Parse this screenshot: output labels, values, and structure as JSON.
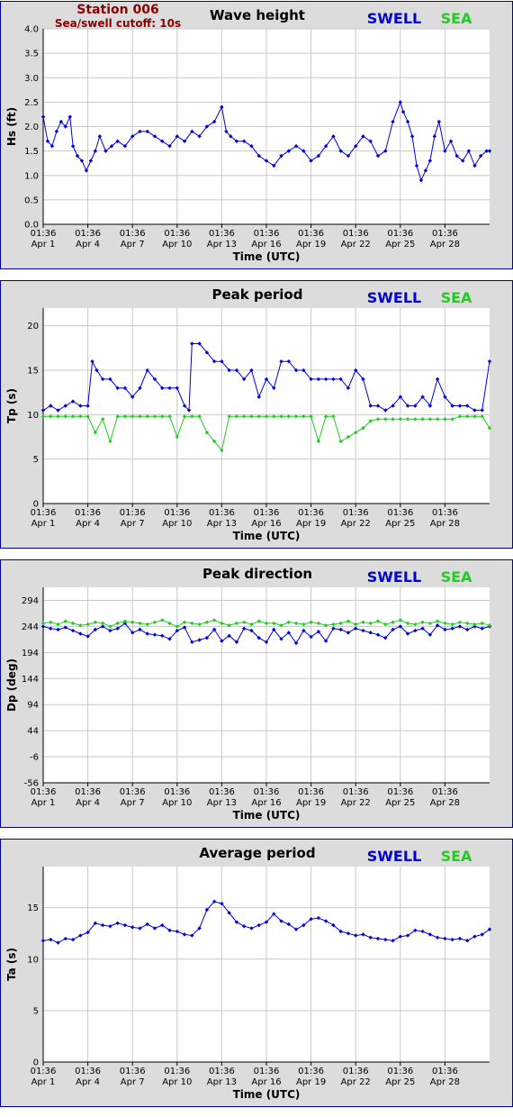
{
  "header": {
    "station": "Station 006",
    "cutoff": "Sea/swell cutoff: 10s"
  },
  "legend": {
    "swell": "SWELL",
    "sea": "SEA"
  },
  "colors": {
    "swell": "#0000dd",
    "sea": "#22cc22",
    "frame": "#0000a0"
  },
  "x_ticks": [
    {
      "time": "01:36",
      "date": "Apr 1",
      "day": 0
    },
    {
      "time": "01:36",
      "date": "Apr 4",
      "day": 3
    },
    {
      "time": "01:36",
      "date": "Apr 7",
      "day": 6
    },
    {
      "time": "01:36",
      "date": "Apr 10",
      "day": 9
    },
    {
      "time": "01:36",
      "date": "Apr 13",
      "day": 12
    },
    {
      "time": "01:36",
      "date": "Apr 16",
      "day": 15
    },
    {
      "time": "01:36",
      "date": "Apr 19",
      "day": 18
    },
    {
      "time": "01:36",
      "date": "Apr 22",
      "day": 21
    },
    {
      "time": "01:36",
      "date": "Apr 25",
      "day": 24
    },
    {
      "time": "01:36",
      "date": "Apr 28",
      "day": 27
    }
  ],
  "chart_data": [
    {
      "type": "line",
      "title": "Wave height",
      "xlabel": "Time (UTC)",
      "ylabel": "Hs (ft)",
      "xlim": [
        0,
        30
      ],
      "ylim": [
        0,
        4
      ],
      "yticks": [
        "0.0",
        "0.5",
        "1.0",
        "1.5",
        "2.0",
        "2.5",
        "3.0",
        "3.5",
        "4.0"
      ],
      "grid": true,
      "series": [
        {
          "name": "SWELL",
          "color": "#0000dd",
          "x": [
            0,
            0.3,
            0.6,
            0.9,
            1.2,
            1.5,
            1.8,
            2.0,
            2.3,
            2.6,
            2.9,
            3.2,
            3.5,
            3.8,
            4.2,
            4.6,
            5.0,
            5.5,
            6.0,
            6.5,
            7.0,
            7.5,
            8.0,
            8.5,
            9.0,
            9.5,
            10.0,
            10.5,
            11.0,
            11.5,
            12.0,
            12.3,
            12.6,
            13.0,
            13.5,
            14.0,
            14.5,
            15.0,
            15.5,
            16.0,
            16.5,
            17.0,
            17.5,
            18.0,
            18.5,
            19.0,
            19.5,
            20.0,
            20.5,
            21.0,
            21.5,
            22.0,
            22.5,
            23.0,
            23.5,
            24.0,
            24.2,
            24.5,
            24.8,
            25.1,
            25.4,
            25.7,
            26.0,
            26.3,
            26.6,
            27.0,
            27.4,
            27.8,
            28.2,
            28.6,
            29.0,
            29.4,
            29.8,
            30.0
          ],
          "y": [
            2.2,
            1.7,
            1.6,
            1.9,
            2.1,
            2.0,
            2.2,
            1.6,
            1.4,
            1.3,
            1.1,
            1.3,
            1.5,
            1.8,
            1.5,
            1.6,
            1.7,
            1.6,
            1.8,
            1.9,
            1.9,
            1.8,
            1.7,
            1.6,
            1.8,
            1.7,
            1.9,
            1.8,
            2.0,
            2.1,
            2.4,
            1.9,
            1.8,
            1.7,
            1.7,
            1.6,
            1.4,
            1.3,
            1.2,
            1.4,
            1.5,
            1.6,
            1.5,
            1.3,
            1.4,
            1.6,
            1.8,
            1.5,
            1.4,
            1.6,
            1.8,
            1.7,
            1.4,
            1.5,
            2.1,
            2.5,
            2.3,
            2.1,
            1.8,
            1.2,
            0.9,
            1.1,
            1.3,
            1.8,
            2.1,
            1.5,
            1.7,
            1.4,
            1.3,
            1.5,
            1.2,
            1.4,
            1.5,
            1.5
          ]
        }
      ]
    },
    {
      "type": "line",
      "title": "Peak period",
      "xlabel": "Time (UTC)",
      "ylabel": "Tp (s)",
      "xlim": [
        0,
        30
      ],
      "ylim": [
        0,
        22
      ],
      "yticks": [
        "0",
        "5",
        "10",
        "15",
        "20"
      ],
      "grid": true,
      "series": [
        {
          "name": "SWELL",
          "color": "#0000dd",
          "x": [
            0,
            0.5,
            1.0,
            1.5,
            2.0,
            2.5,
            3.0,
            3.3,
            3.6,
            4.0,
            4.5,
            5.0,
            5.5,
            6.0,
            6.5,
            7.0,
            7.5,
            8.0,
            8.5,
            9.0,
            9.5,
            9.8,
            10.0,
            10.5,
            11.0,
            11.5,
            12.0,
            12.5,
            13.0,
            13.5,
            14.0,
            14.5,
            15.0,
            15.5,
            16.0,
            16.5,
            17.0,
            17.5,
            18.0,
            18.5,
            19.0,
            19.5,
            20.0,
            20.5,
            21.0,
            21.5,
            22.0,
            22.5,
            23.0,
            23.5,
            24.0,
            24.5,
            25.0,
            25.5,
            26.0,
            26.5,
            27.0,
            27.5,
            28.0,
            28.5,
            29.0,
            29.5,
            30.0
          ],
          "y": [
            10.5,
            11,
            10.5,
            11,
            11.5,
            11,
            11,
            16,
            15,
            14,
            14,
            13,
            13,
            12,
            13,
            15,
            14,
            13,
            13,
            13,
            11,
            10.5,
            18,
            18,
            17,
            16,
            16,
            15,
            15,
            14,
            15,
            12,
            14,
            13,
            16,
            16,
            15,
            15,
            14,
            14,
            14,
            14,
            14,
            13,
            15,
            14,
            11,
            11,
            10.5,
            11,
            12,
            11,
            11,
            12,
            11,
            14,
            12,
            11,
            11,
            11,
            10.5,
            10.5,
            16
          ]
        },
        {
          "name": "SEA",
          "color": "#22cc22",
          "x": [
            0,
            0.5,
            1.0,
            1.5,
            2.0,
            2.5,
            3.0,
            3.5,
            4.0,
            4.5,
            5.0,
            5.5,
            6.0,
            6.5,
            7.0,
            7.5,
            8.0,
            8.5,
            9.0,
            9.5,
            10.0,
            10.5,
            11.0,
            11.5,
            12.0,
            12.5,
            13.0,
            13.5,
            14.0,
            14.5,
            15.0,
            15.5,
            16.0,
            16.5,
            17.0,
            17.5,
            18.0,
            18.5,
            19.0,
            19.5,
            20.0,
            20.5,
            21.0,
            21.5,
            22.0,
            22.5,
            23.0,
            23.5,
            24.0,
            24.5,
            25.0,
            25.5,
            26.0,
            26.5,
            27.0,
            27.5,
            28.0,
            28.5,
            29.0,
            29.5,
            30.0
          ],
          "y": [
            9.8,
            9.8,
            9.8,
            9.8,
            9.8,
            9.8,
            9.8,
            8,
            9.5,
            7,
            9.8,
            9.8,
            9.8,
            9.8,
            9.8,
            9.8,
            9.8,
            9.8,
            7.5,
            9.8,
            9.8,
            9.8,
            8,
            7,
            6,
            9.8,
            9.8,
            9.8,
            9.8,
            9.8,
            9.8,
            9.8,
            9.8,
            9.8,
            9.8,
            9.8,
            9.8,
            7,
            9.8,
            9.8,
            7,
            7.5,
            8,
            8.5,
            9.3,
            9.5,
            9.5,
            9.5,
            9.5,
            9.5,
            9.5,
            9.5,
            9.5,
            9.5,
            9.5,
            9.5,
            9.8,
            9.8,
            9.8,
            9.8,
            8.5
          ]
        }
      ]
    },
    {
      "type": "line",
      "title": "Peak direction",
      "xlabel": "Time (UTC)",
      "ylabel": "Dp (deg)",
      "xlim": [
        0,
        30
      ],
      "ylim": [
        -56,
        319
      ],
      "yticks": [
        "-56",
        "-6",
        "44",
        "94",
        "144",
        "194",
        "244",
        "294"
      ],
      "grid": true,
      "series": [
        {
          "name": "SWELL",
          "color": "#0000dd",
          "x": [
            0,
            0.5,
            1.0,
            1.5,
            2.0,
            2.5,
            3.0,
            3.5,
            4.0,
            4.5,
            5.0,
            5.5,
            6.0,
            6.5,
            7.0,
            7.5,
            8.0,
            8.5,
            9.0,
            9.5,
            10.0,
            10.5,
            11.0,
            11.5,
            12.0,
            12.5,
            13.0,
            13.5,
            14.0,
            14.5,
            15.0,
            15.5,
            16.0,
            16.5,
            17.0,
            17.5,
            18.0,
            18.5,
            19.0,
            19.5,
            20.0,
            20.5,
            21.0,
            21.5,
            22.0,
            22.5,
            23.0,
            23.5,
            24.0,
            24.5,
            25.0,
            25.5,
            26.0,
            26.5,
            27.0,
            27.5,
            28.0,
            28.5,
            29.0,
            29.5,
            30.0
          ],
          "y": [
            244,
            240,
            238,
            242,
            236,
            230,
            225,
            238,
            244,
            236,
            240,
            250,
            232,
            238,
            230,
            228,
            226,
            220,
            236,
            242,
            214,
            218,
            222,
            238,
            216,
            226,
            214,
            240,
            236,
            222,
            214,
            238,
            220,
            232,
            212,
            236,
            224,
            234,
            216,
            240,
            238,
            232,
            240,
            236,
            232,
            228,
            222,
            238,
            244,
            230,
            236,
            240,
            228,
            246,
            238,
            240,
            244,
            238,
            244,
            240,
            244
          ]
        },
        {
          "name": "SEA",
          "color": "#22cc22",
          "x": [
            0,
            0.5,
            1.0,
            1.5,
            2.0,
            2.5,
            3.0,
            3.5,
            4.0,
            4.5,
            5.0,
            5.5,
            6.0,
            6.5,
            7.0,
            7.5,
            8.0,
            8.5,
            9.0,
            9.5,
            10.0,
            10.5,
            11.0,
            11.5,
            12.0,
            12.5,
            13.0,
            13.5,
            14.0,
            14.5,
            15.0,
            15.5,
            16.0,
            16.5,
            17.0,
            17.5,
            18.0,
            18.5,
            19.0,
            19.5,
            20.0,
            20.5,
            21.0,
            21.5,
            22.0,
            22.5,
            23.0,
            23.5,
            24.0,
            24.5,
            25.0,
            25.5,
            26.0,
            26.5,
            27.0,
            27.5,
            28.0,
            28.5,
            29.0,
            29.5,
            30.0
          ],
          "y": [
            250,
            252,
            248,
            254,
            250,
            246,
            248,
            252,
            250,
            244,
            250,
            254,
            252,
            250,
            248,
            252,
            256,
            250,
            244,
            252,
            250,
            248,
            252,
            256,
            250,
            246,
            250,
            252,
            248,
            254,
            250,
            250,
            246,
            252,
            250,
            248,
            252,
            250,
            246,
            248,
            250,
            254,
            248,
            252,
            250,
            254,
            248,
            252,
            256,
            250,
            248,
            252,
            250,
            254,
            250,
            248,
            252,
            250,
            248,
            250,
            246
          ]
        }
      ]
    },
    {
      "type": "line",
      "title": "Average period",
      "xlabel": "Time (UTC)",
      "ylabel": "Ta (s)",
      "xlim": [
        0,
        30
      ],
      "ylim": [
        0,
        19
      ],
      "yticks": [
        "0",
        "5",
        "10",
        "15"
      ],
      "grid": true,
      "series": [
        {
          "name": "SWELL",
          "color": "#0000dd",
          "x": [
            0,
            0.5,
            1.0,
            1.5,
            2.0,
            2.5,
            3.0,
            3.5,
            4.0,
            4.5,
            5.0,
            5.5,
            6.0,
            6.5,
            7.0,
            7.5,
            8.0,
            8.5,
            9.0,
            9.5,
            10.0,
            10.5,
            11.0,
            11.5,
            12.0,
            12.5,
            13.0,
            13.5,
            14.0,
            14.5,
            15.0,
            15.5,
            16.0,
            16.5,
            17.0,
            17.5,
            18.0,
            18.5,
            19.0,
            19.5,
            20.0,
            20.5,
            21.0,
            21.5,
            22.0,
            22.5,
            23.0,
            23.5,
            24.0,
            24.5,
            25.0,
            25.5,
            26.0,
            26.5,
            27.0,
            27.5,
            28.0,
            28.5,
            29.0,
            29.5,
            30.0
          ],
          "y": [
            11.8,
            11.9,
            11.6,
            12.0,
            11.9,
            12.3,
            12.6,
            13.5,
            13.3,
            13.2,
            13.5,
            13.3,
            13.1,
            13.0,
            13.4,
            13.0,
            13.3,
            12.8,
            12.7,
            12.4,
            12.3,
            13.0,
            14.8,
            15.6,
            15.4,
            14.5,
            13.6,
            13.2,
            13.0,
            13.3,
            13.6,
            14.4,
            13.7,
            13.4,
            12.9,
            13.3,
            13.9,
            14.0,
            13.7,
            13.3,
            12.7,
            12.5,
            12.3,
            12.4,
            12.1,
            12.0,
            11.9,
            11.8,
            12.2,
            12.3,
            12.8,
            12.7,
            12.4,
            12.1,
            12.0,
            11.9,
            12.0,
            11.8,
            12.2,
            12.4,
            12.9
          ]
        }
      ]
    }
  ]
}
